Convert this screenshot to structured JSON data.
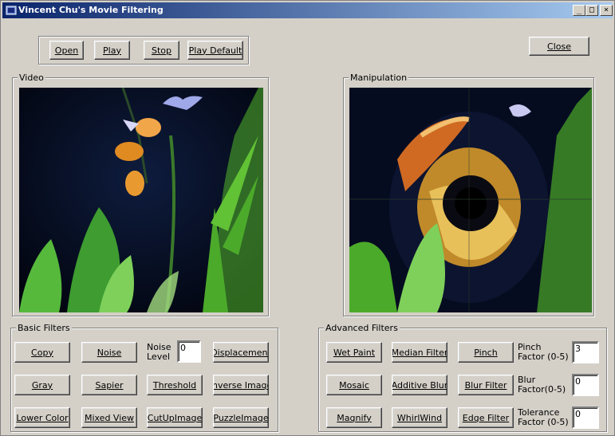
{
  "window": {
    "title": "Vincent Chu's Movie Filtering"
  },
  "titlebar_buttons": {
    "minimize": "_",
    "maximize": "□",
    "close": "×"
  },
  "toolbar": {
    "open": "Open",
    "play": "Play",
    "stop": "Stop",
    "play_default": "Play Default"
  },
  "close_button": "Close",
  "video": {
    "label": "Video"
  },
  "manipulation": {
    "label": "Manipulation"
  },
  "basic_filters": {
    "label": "Basic Filters",
    "copy": "Copy",
    "noise": "Noise",
    "noise_level_label": "Noise Level",
    "noise_level_value": "0",
    "displacement": "Displacement",
    "gray": "Gray",
    "sapier": "Sapier",
    "threshold": "Threshold",
    "inverse_image": "Inverse Image",
    "lower_color": "Lower Color",
    "mixed_view": "Mixed View",
    "cutup_image": "CutUpImage",
    "puzzle_image": "PuzzleImage"
  },
  "advanced_filters": {
    "label": "Advanced Filters",
    "wet_paint": "Wet Paint",
    "median_filter": "Median Filter",
    "pinch": "Pinch",
    "pinch_factor_label": "Pinch Factor (0-5)",
    "pinch_factor_value": "3",
    "mosaic": "Mosaic",
    "additive_blur": "Additive Blur",
    "blur_filter": "Blur Filter",
    "blur_factor_label": "Blur Factor(0-5)",
    "blur_factor_value": "0",
    "magnify": "Magnify",
    "whirlwind": "WhirlWind",
    "edge_filter": "Edge Filter",
    "tolerance_factor_label": "Tolerance Factor (0-5)",
    "tolerance_factor_value": "0"
  }
}
